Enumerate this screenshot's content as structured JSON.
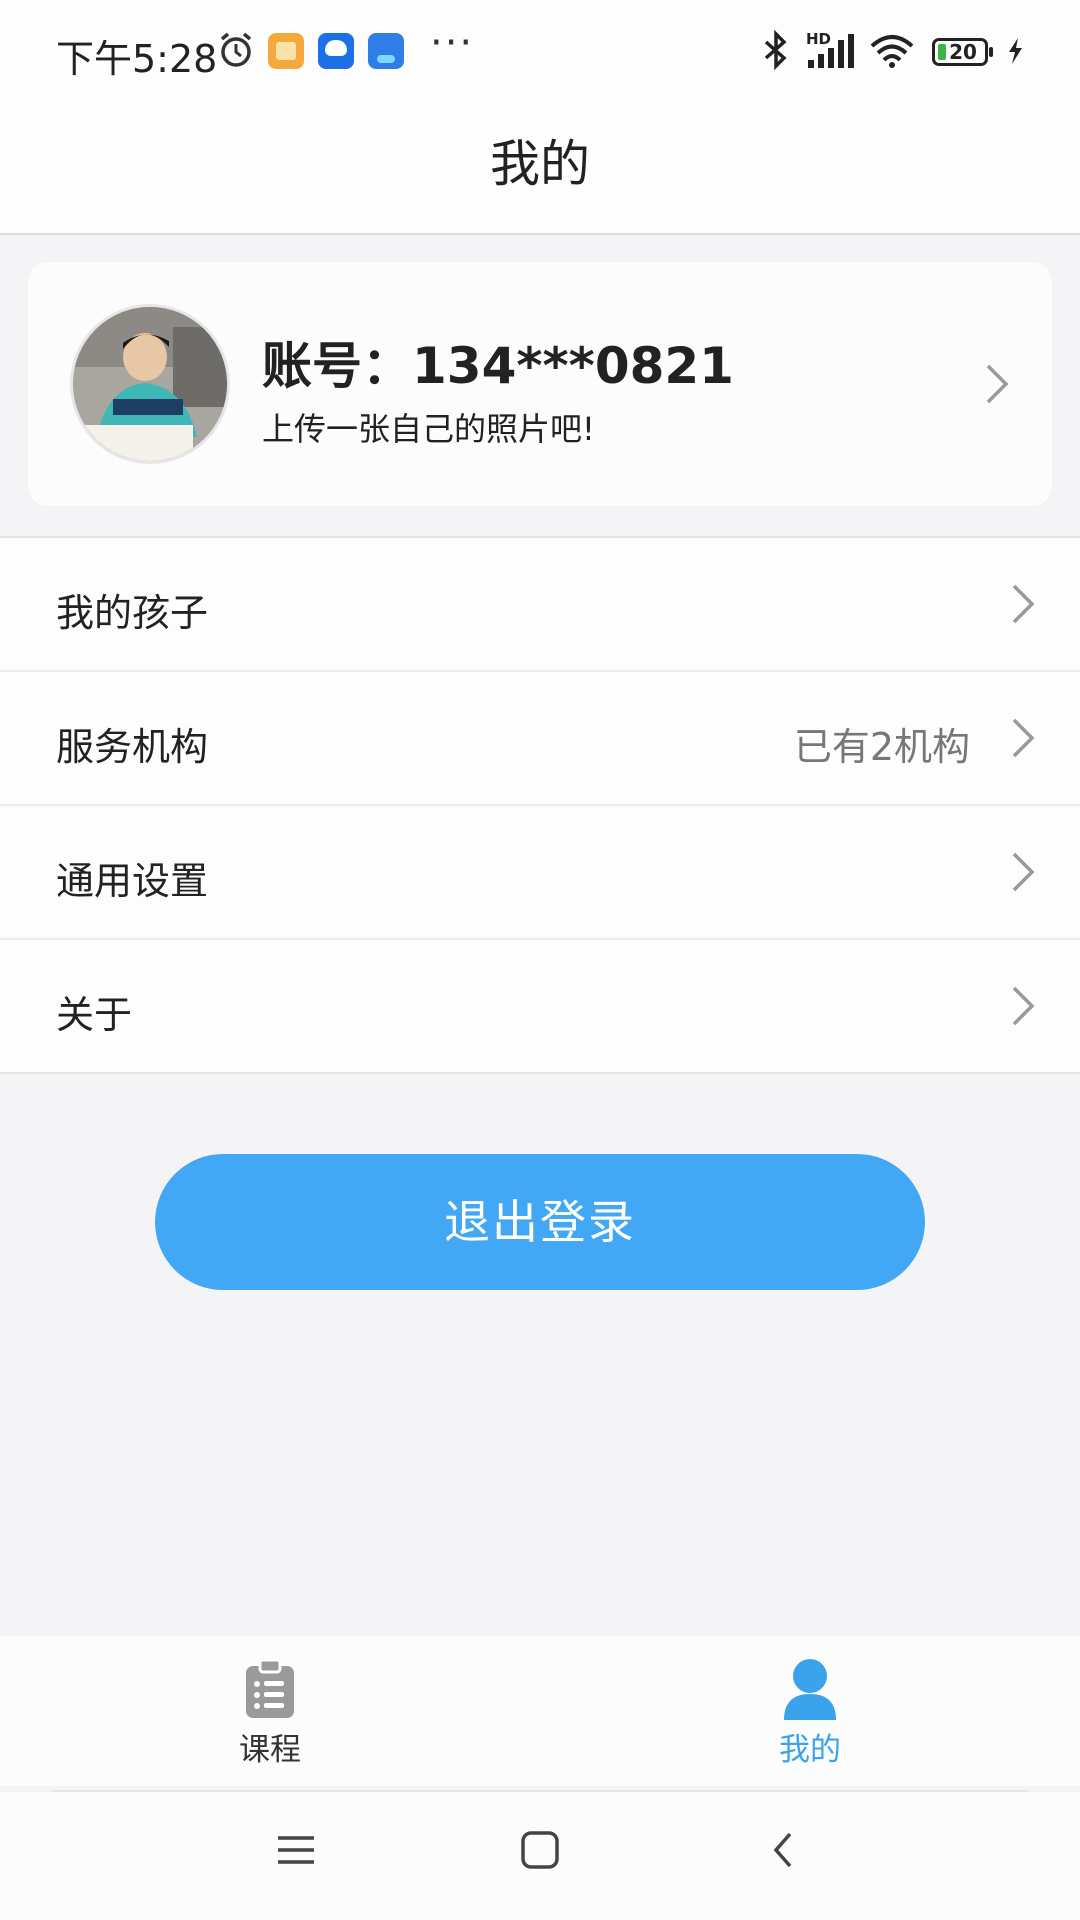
{
  "status_bar": {
    "time": "下午5:28",
    "icons": [
      "alarm-icon",
      "notes-app-icon",
      "baidu-app-icon",
      "autohome-app-icon",
      "more-dots-icon",
      "bluetooth-icon",
      "signal-icon",
      "wifi-icon",
      "battery-icon",
      "charging-icon"
    ],
    "more": "···",
    "battery_level": "20",
    "signal_label": "HD"
  },
  "header": {
    "title": "我的"
  },
  "profile": {
    "account_prefix": "账号：",
    "account_number": "134***0821",
    "subtitle": "上传一张自己的照片吧!"
  },
  "menu": [
    {
      "label": "我的孩子",
      "value": ""
    },
    {
      "label": "服务机构",
      "value": "已有2机构"
    },
    {
      "label": "通用设置",
      "value": ""
    },
    {
      "label": "关于",
      "value": ""
    }
  ],
  "logout_label": "退出登录",
  "tabbar": {
    "tabs": [
      {
        "label": "课程",
        "icon": "clipboard-icon",
        "active": false
      },
      {
        "label": "我的",
        "icon": "person-icon",
        "active": true
      }
    ]
  },
  "colors": {
    "accent": "#42a8f5",
    "active_tab": "#3ba3ec",
    "background": "#f4f4f6"
  }
}
